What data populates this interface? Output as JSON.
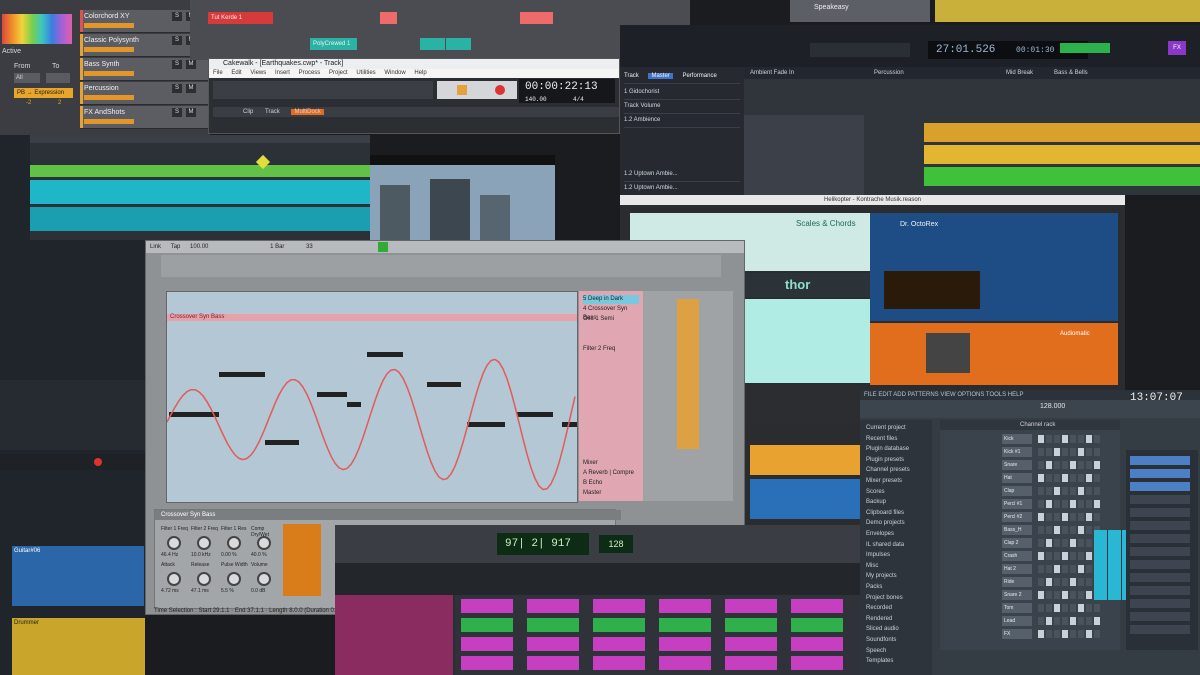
{
  "bitwig": {
    "panel_labels": [
      "Active",
      "From",
      "To",
      "All"
    ],
    "expression_label": "PB → Expression",
    "expr_values": [
      "-2",
      "2"
    ],
    "tracks": [
      {
        "name": "Colorchord XY",
        "color": "#e05151"
      },
      {
        "name": "Classic Polysynth",
        "color": "#e6a236"
      },
      {
        "name": "Bass Synth",
        "color": "#e6a236"
      },
      {
        "name": "Percussion",
        "color": "#e6a236"
      },
      {
        "name": "FX AndShots",
        "color": "#e6a236"
      }
    ],
    "solo_mute": [
      "S",
      "M"
    ],
    "clip_labels": [
      "Tut Kerde 1",
      "PolyCrewed 1"
    ]
  },
  "cakewalk": {
    "title": "Cakewalk - [Earthquakes.cwp* - Track]",
    "menu": [
      "File",
      "Edit",
      "Views",
      "Insert",
      "Process",
      "Project",
      "Utilities",
      "Window",
      "Help"
    ],
    "time": "00:00:22:13",
    "tempo": "140.00",
    "meter": "4/4",
    "tabs": [
      "Clip",
      "Track",
      "MultiDock"
    ]
  },
  "studioone": {
    "clock": "27:01.526",
    "end_time": "00:01:30",
    "labels": [
      "Track",
      "Master",
      "Performance"
    ],
    "inspector_rows": [
      "1 Gidochorist",
      "Track Volume",
      "1.2 Ambience",
      "1.2 Uptown Ambie...",
      "1.2 Uptown Ambie...",
      "1.2 Vocals"
    ],
    "markers": [
      "Ambient Fade In",
      "Percussion",
      "Mid Break",
      "Bass & Bells"
    ],
    "speakeasy": "Speakeasy"
  },
  "ableton": {
    "clip_name": "Crossover Syn Bass",
    "device_name": "Crossover Syn Bass",
    "track_list": [
      "5 Deep in Dark",
      "4 Crossover Syn Bass",
      "Osc 1 Semi",
      "Filter 2 Freq"
    ],
    "returns": [
      "A Reverb | Compre",
      "B Echo",
      "Master"
    ],
    "knobs": [
      "Filter 1 Freq",
      "Filter 2 Freq",
      "Filter 1 Res",
      "Comp Dry/Wet",
      "Attack",
      "Release",
      "Pulse Width",
      "Volume"
    ],
    "knob_values": [
      "46.4 Hz",
      "10.0 kHz",
      "0.00 %",
      "40.0 %",
      "4.72 ms",
      "47.1 ms",
      "5.5 %",
      "0.0 dB"
    ],
    "status": "Time Selection : Start 29.1.1 · End 37.1.1 · Length 8.0.0 (Duration 0:13)",
    "mixer_label": "Mixer",
    "toolbar_values": [
      "Link",
      "Tap",
      "100.00",
      "1 Bar",
      "33",
      "1",
      "1"
    ]
  },
  "reason": {
    "title": "Helikopter - Kontrache Musik.reason",
    "scales_label": "Scales & Chords",
    "thor_label": "thor",
    "dr_label": "Dr. OctoRex",
    "audiomatic": "Audiomatic"
  },
  "flstudio": {
    "menu": "FILE  EDIT  ADD  PATTERNS  VIEW  OPTIONS  TOOLS  HELP",
    "clock": "13:07:07",
    "tempo": "128.000",
    "channel_rack": "Channel rack",
    "browser": [
      "Current project",
      "Recent files",
      "Plugin database",
      "Plugin presets",
      "Channel presets",
      "Mixer presets",
      "Scores",
      "Backup",
      "Clipboard files",
      "Demo projects",
      "Envelopes",
      "IL shared data",
      "Impulses",
      "Misc",
      "My projects",
      "Packs",
      "Project bones",
      "Recorded",
      "Rendered",
      "Sliced audio",
      "Soundfonts",
      "Speech",
      "Templates"
    ],
    "channels": [
      "Kick",
      "Kick #1",
      "Snare",
      "Hat",
      "Clap",
      "Percl #1",
      "Percl #2",
      "Bass_H",
      "Clap 2",
      "Crash",
      "Hat 2",
      "Ride",
      "Snare 2",
      "Tom",
      "Lead",
      "FX"
    ]
  },
  "lowerleft": {
    "guitar_label": "Guitar#06",
    "drummer_label": "Drummer"
  },
  "logic": {
    "lcd": "97| 2| 917",
    "tempo": "128"
  }
}
